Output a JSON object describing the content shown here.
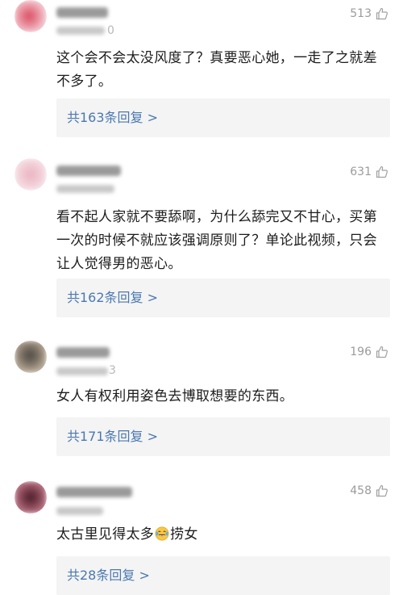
{
  "comments": [
    {
      "time_tail": "0",
      "likes": "513",
      "text": "这个会不会太没风度了？真要恶心她，一走了之就差不多了。",
      "reply_label": "共163条回复 >",
      "avatar_colors": [
        "#f2c7cf",
        "#d94d62"
      ]
    },
    {
      "time_tail": "",
      "likes": "631",
      "text": "看不起人家就不要舔啊，为什么舔完又不甘心，买第一次的时候不就应该强调原则了？单论此视频，只会让人觉得男的恶心。",
      "reply_label": "共162条回复 >",
      "avatar_colors": [
        "#f4dde3",
        "#eab3c0"
      ]
    },
    {
      "time_tail": "3",
      "likes": "196",
      "text": "女人有权利用姿色去博取想要的东西。",
      "reply_label": "共171条回复 >",
      "avatar_colors": [
        "#c7b8a6",
        "#4e4a44"
      ]
    },
    {
      "time_tail": "",
      "likes": "458",
      "text_before_emoji": "太古里见得太多",
      "emoji": "laughing-tears",
      "text_after_emoji": "捞女",
      "reply_label": "共28条回复 >",
      "avatar_colors": [
        "#c77d8d",
        "#4a1f2a"
      ]
    }
  ]
}
